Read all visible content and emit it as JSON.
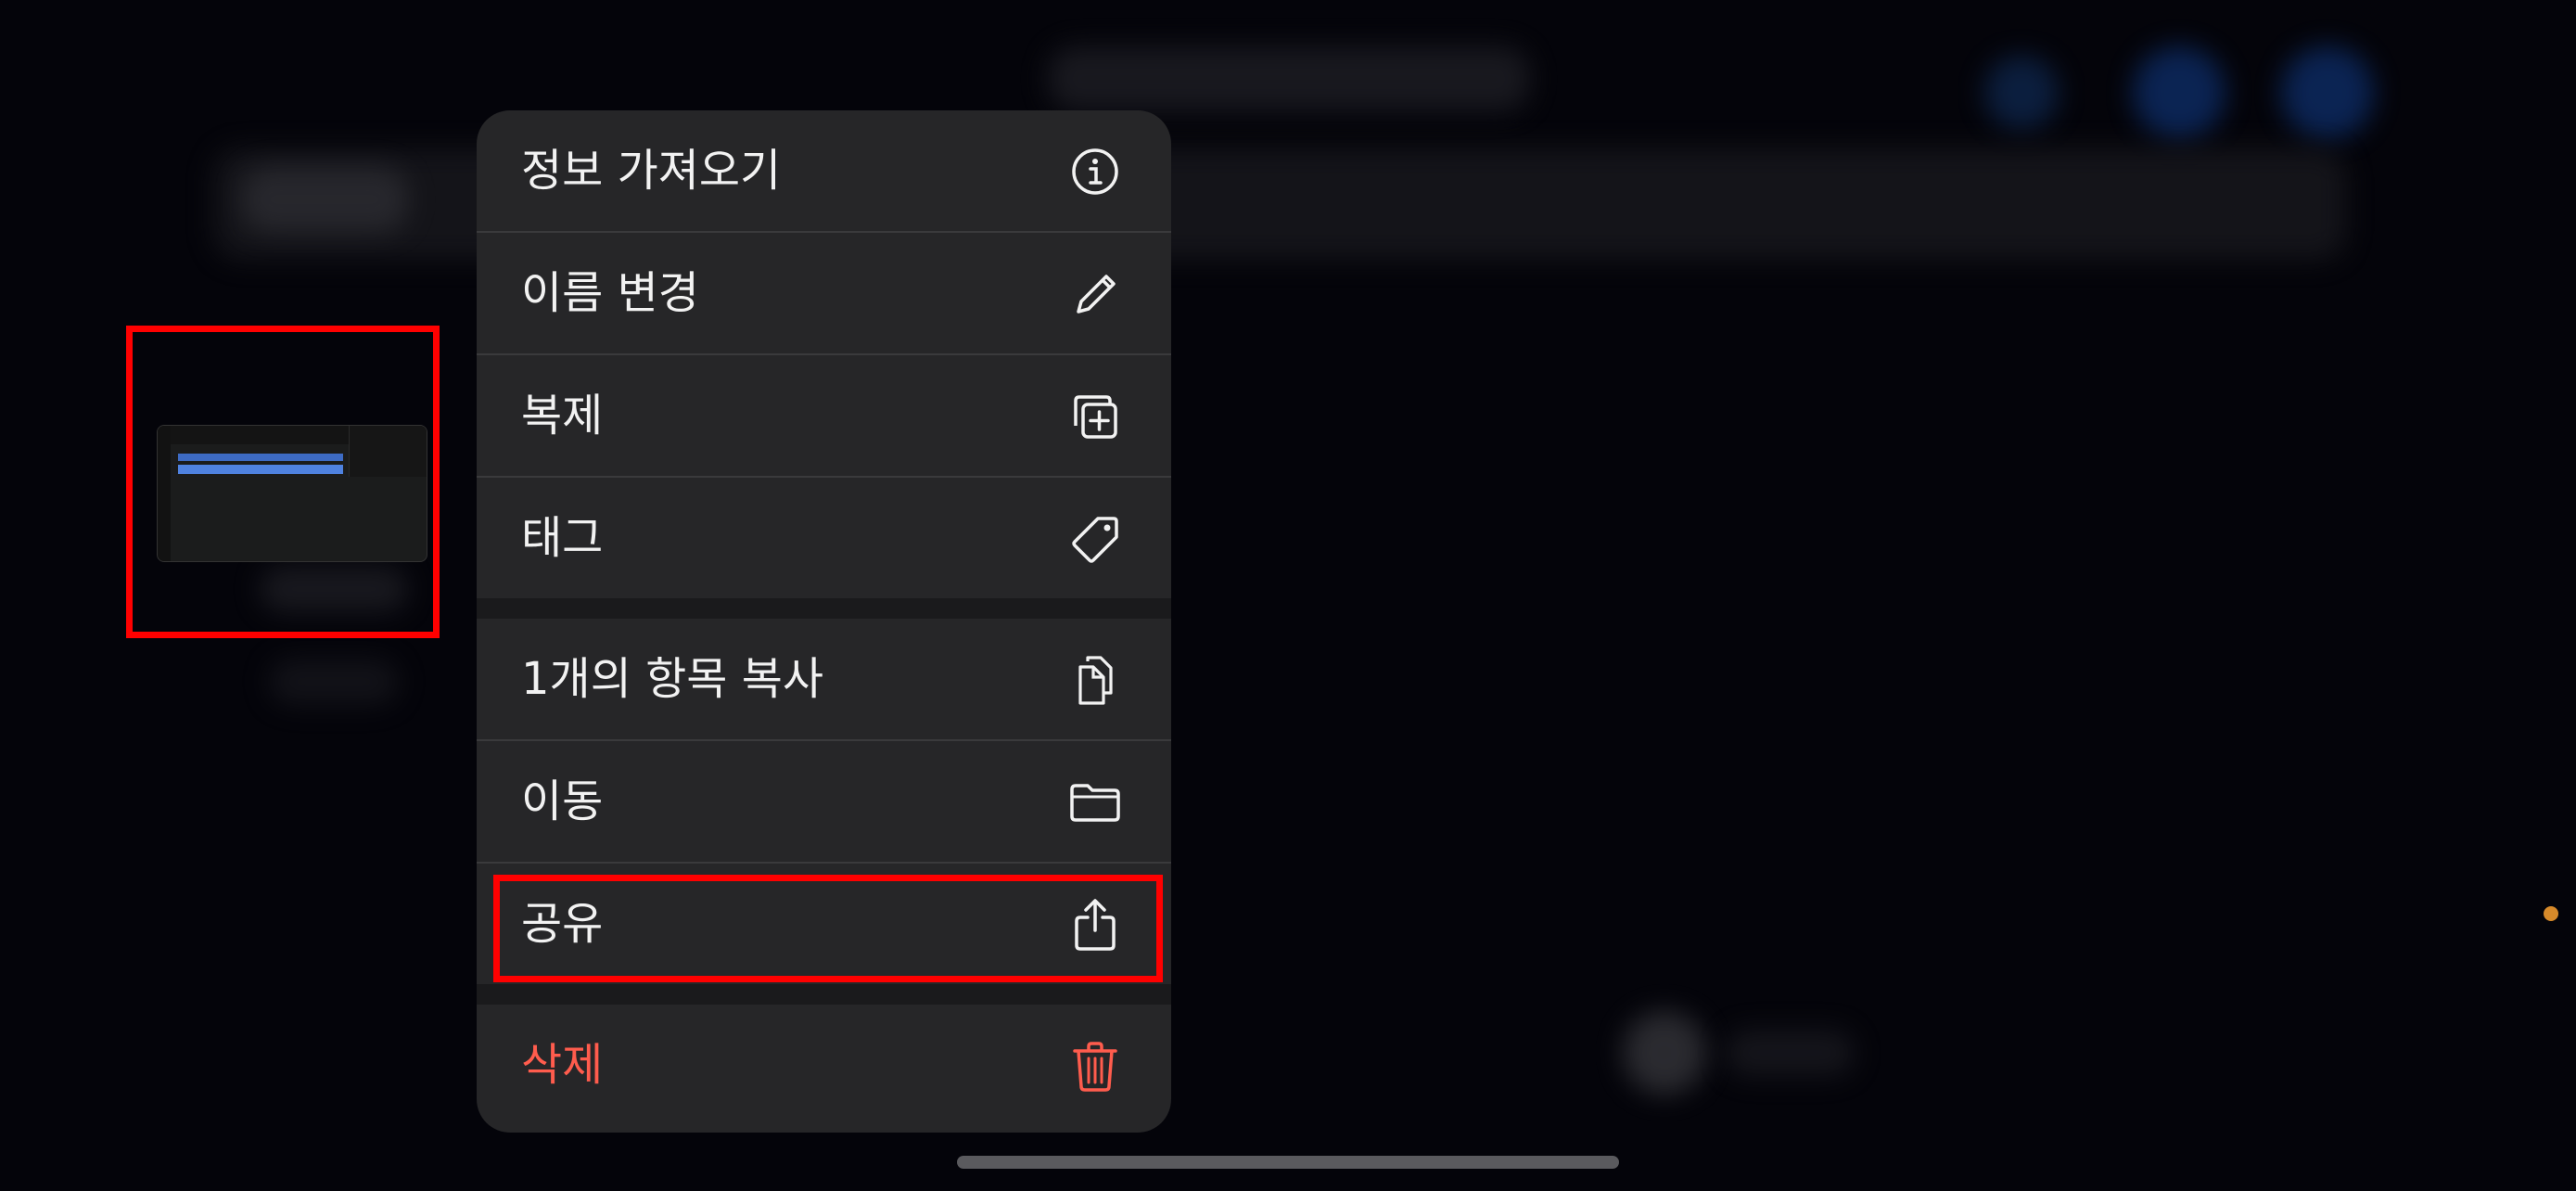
{
  "context_menu": {
    "items": [
      {
        "label": "정보 가져오기",
        "icon": "info-circle-icon"
      },
      {
        "label": "이름 변경",
        "icon": "pencil-icon"
      },
      {
        "label": "복제",
        "icon": "duplicate-plus-icon"
      },
      {
        "label": "태그",
        "icon": "tag-icon"
      },
      {
        "label": "1개의 항목 복사",
        "icon": "copy-documents-icon"
      },
      {
        "label": "이동",
        "icon": "folder-icon"
      },
      {
        "label": "공유",
        "icon": "share-icon"
      },
      {
        "label": "삭제",
        "icon": "trash-icon"
      }
    ]
  },
  "colors": {
    "menu_background": "#262628",
    "destructive": "#ff5c4d",
    "highlight_border": "#ff0000",
    "text": "#f2f2f2"
  }
}
